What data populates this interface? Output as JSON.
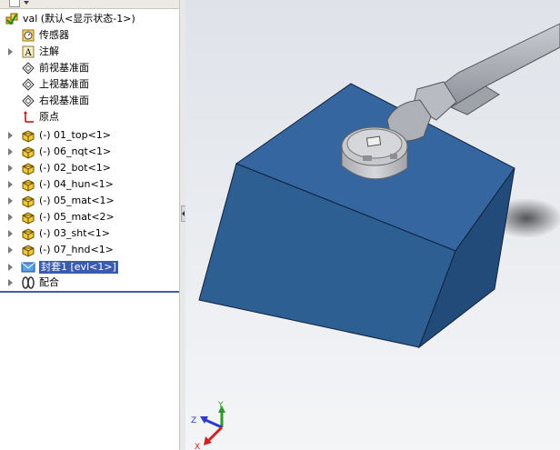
{
  "tree": {
    "root": {
      "label": "val (默认<显示状态-1>)",
      "icon": "assembly-icon"
    },
    "items": [
      {
        "label": "传感器",
        "icon": "sensor-icon",
        "expandable": false
      },
      {
        "label": "注解",
        "icon": "annotation-icon",
        "expandable": true
      },
      {
        "label": "前视基准面",
        "icon": "plane-icon",
        "expandable": false
      },
      {
        "label": "上视基准面",
        "icon": "plane-icon",
        "expandable": false
      },
      {
        "label": "右视基准面",
        "icon": "plane-icon",
        "expandable": false
      },
      {
        "label": "原点",
        "icon": "origin-icon",
        "expandable": false
      },
      {
        "label": "(-) 01_top<1>",
        "icon": "part-icon",
        "expandable": true
      },
      {
        "label": "(-) 06_nqt<1>",
        "icon": "part-icon",
        "expandable": true
      },
      {
        "label": "(-) 02_bot<1>",
        "icon": "part-icon",
        "expandable": true
      },
      {
        "label": "(-) 04_hun<1>",
        "icon": "part-icon",
        "expandable": true
      },
      {
        "label": "(-) 05_mat<1>",
        "icon": "part-icon",
        "expandable": true
      },
      {
        "label": "(-) 05_mat<2>",
        "icon": "part-icon",
        "expandable": true
      },
      {
        "label": "(-) 03_sht<1>",
        "icon": "part-icon",
        "expandable": true
      },
      {
        "label": "(-) 07_hnd<1>",
        "icon": "part-icon",
        "expandable": true
      },
      {
        "label": "封套1 [evl<1>]",
        "icon": "envelope-icon",
        "expandable": true,
        "selected": true
      },
      {
        "label": "配合",
        "icon": "mates-icon",
        "expandable": true
      }
    ]
  },
  "triad": {
    "x": "X",
    "y": "Y",
    "z": "Z"
  },
  "colors": {
    "box": "#2e5f93",
    "accent": "#3b5bb0",
    "viewport_bg": "#e6e9ee"
  }
}
